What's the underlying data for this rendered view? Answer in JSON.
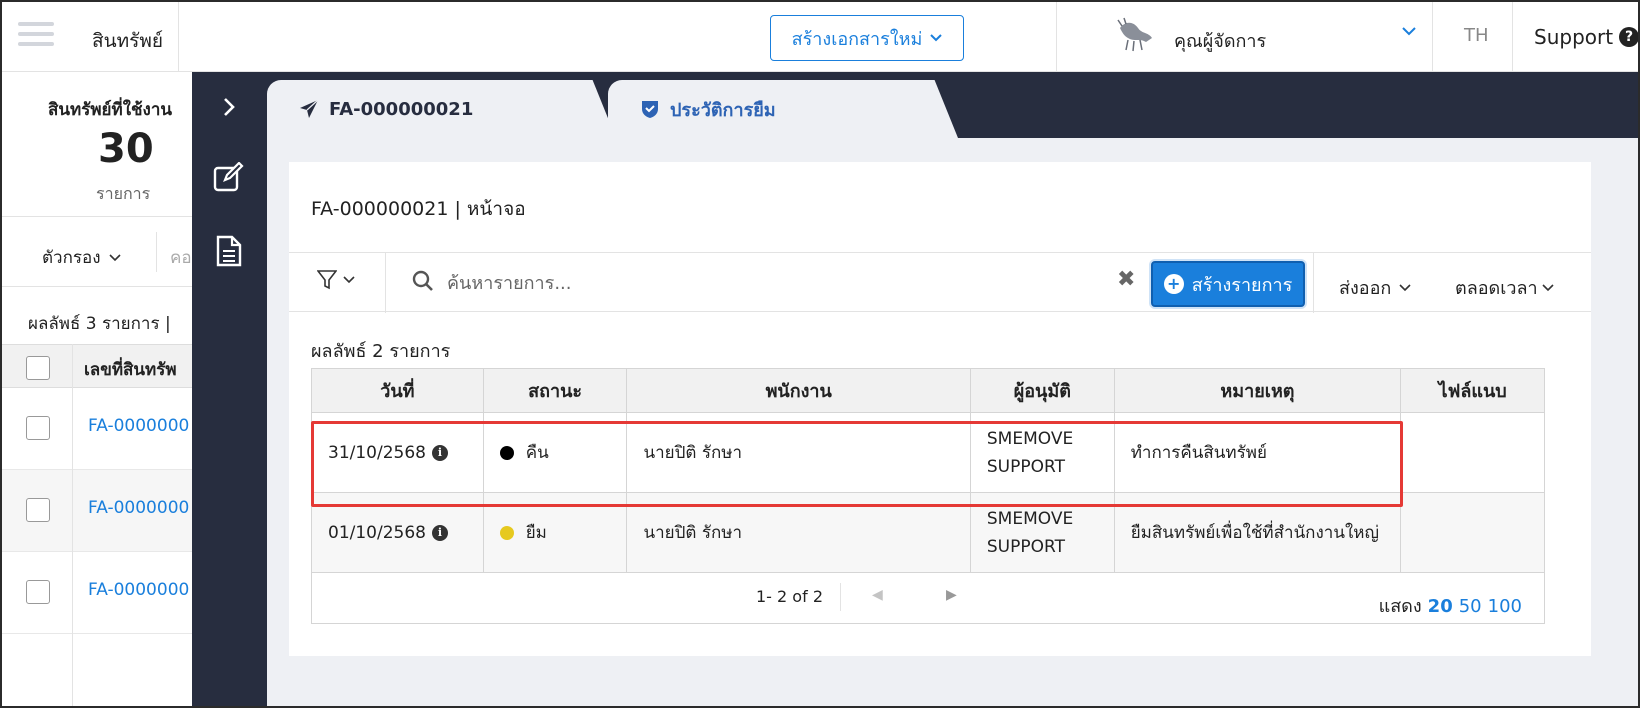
{
  "topbar": {
    "app_title": "สินทรัพย์",
    "new_doc_label": "สร้างเอกสารใหม่",
    "user_name": "คุณผู้จัดการ",
    "lang": "TH",
    "support_label": "Support"
  },
  "left_panel": {
    "summary_label": "สินทรัพย์ที่ใช้งาน",
    "summary_count": "30",
    "summary_unit": "รายการ",
    "filter_label": "ตัวกรอง",
    "filter_cut": "คอ",
    "result_label": "ผลลัพธ์ 3 รายการ  |",
    "column_header": "เลขที่สินทรัพ",
    "rows": [
      "FA-0000000",
      "FA-0000000",
      "FA-0000000"
    ]
  },
  "tabs": [
    {
      "label": "FA-000000021",
      "icon": "paper-plane-icon"
    },
    {
      "label": "ประวัติการยืม",
      "icon": "shield-check-icon"
    }
  ],
  "card": {
    "title": "FA-000000021 | หน้าจอ",
    "search_placeholder": "ค้นหารายการ...",
    "create_label": "สร้างรายการ",
    "export_label": "ส่งออก",
    "time_label": "ตลอดเวลา",
    "result_count": "ผลลัพธ์ 2 รายการ"
  },
  "table": {
    "headers": [
      "วันที่",
      "สถานะ",
      "พนักงาน",
      "ผู้อนุมัติ",
      "หมายเหตุ",
      "ไฟล์แนบ"
    ],
    "rows": [
      {
        "date": "31/10/2568",
        "status": "คืน",
        "status_color": "#000000",
        "employee": "นายปิติ รักษา",
        "approver": "SMEMOVE SUPPORT",
        "note": "ทำการคืนสินทรัพย์",
        "attachment": ""
      },
      {
        "date": "01/10/2568",
        "status": "ยืม",
        "status_color": "#e6c91f",
        "employee": "นายปิติ รักษา",
        "approver": "SMEMOVE SUPPORT",
        "note": "ยืมสินทรัพย์เพื่อใช้ที่สำนักงานใหญ่",
        "attachment": ""
      }
    ],
    "pager_text": "1- 2 of 2",
    "show_label": "แสดง",
    "page_sizes": [
      "20",
      "50",
      "100"
    ]
  },
  "colors": {
    "accent": "#1a7fdc",
    "drawer_bg": "#272d3f",
    "highlight": "#e53935"
  }
}
